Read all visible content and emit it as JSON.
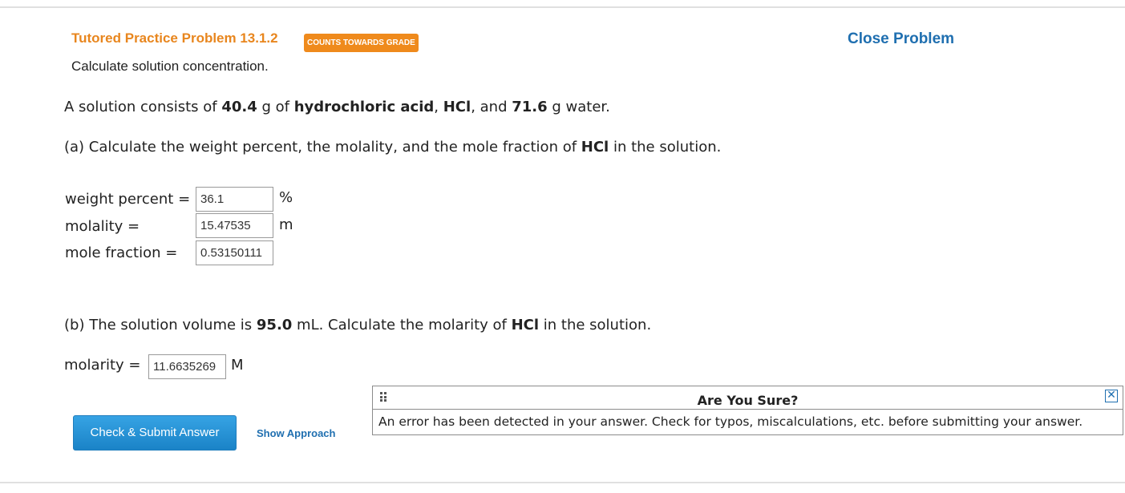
{
  "header": {
    "title": "Tutored Practice Problem 13.1.2",
    "badge": "COUNTS TOWARDS GRADE",
    "close_label": "Close Problem",
    "subtitle": "Calculate solution concentration."
  },
  "problem": {
    "intro": {
      "t1": "A solution consists of ",
      "mass_hcl": "40.4",
      "t2": " g of ",
      "name": "hydrochloric acid",
      "t3": ", ",
      "formula": "HCl",
      "t4": ", and ",
      "mass_water": "71.6",
      "t5": " g water."
    },
    "part_a": {
      "t1": "(a) Calculate the weight percent, the molality, and the mole fraction of ",
      "formula": "HCl",
      "t2": " in the solution."
    },
    "fields_a": [
      {
        "label": "weight percent =",
        "value": "36.1",
        "unit": "%"
      },
      {
        "label": "molality =",
        "value": "15.47535",
        "unit": "m"
      },
      {
        "label": "mole fraction =",
        "value": "0.53150111",
        "unit": ""
      }
    ],
    "part_b": {
      "t1": "(b) The solution volume is ",
      "volume": "95.0",
      "t2": " mL. Calculate the molarity of ",
      "formula": "HCl",
      "t3": " in the solution."
    },
    "field_b": {
      "label": "molarity =",
      "value": "11.6635269",
      "unit": "M"
    }
  },
  "actions": {
    "submit_label": "Check & Submit Answer",
    "approach_label": "Show Approach"
  },
  "popup": {
    "title": "Are You Sure?",
    "close_glyph": "✕",
    "message": "An error has been detected in your answer. Check for typos, miscalculations, etc. before submitting your answer."
  }
}
